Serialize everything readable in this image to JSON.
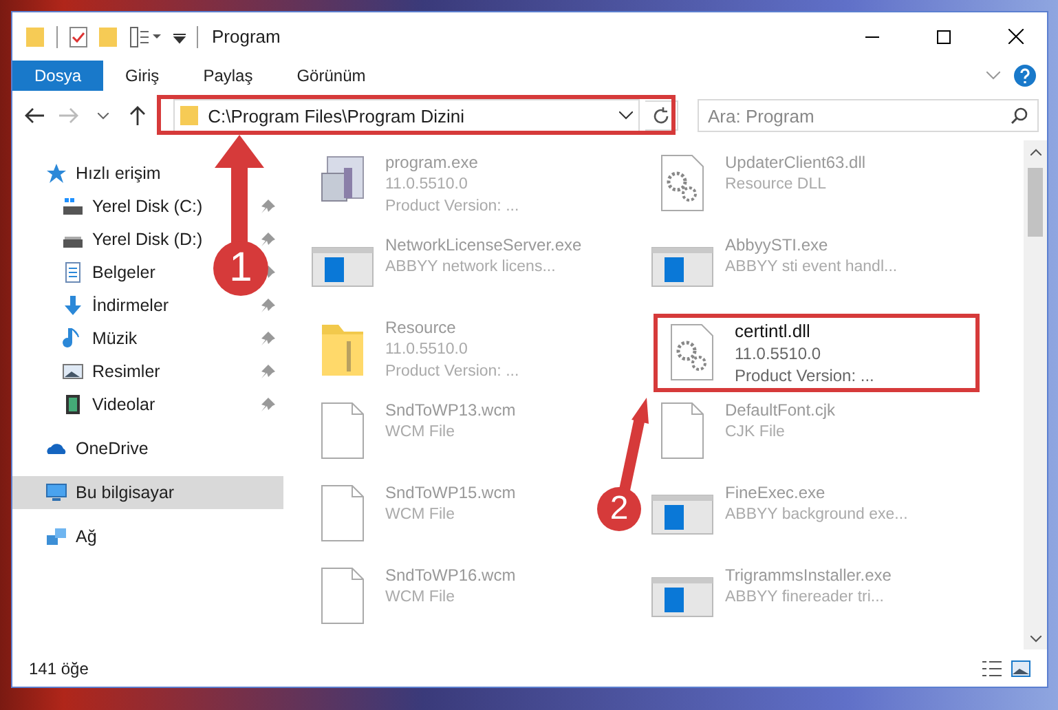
{
  "window": {
    "title": "Program"
  },
  "ribbon_tabs": [
    {
      "label": "Dosya",
      "selected": true
    },
    {
      "label": "Giriş",
      "selected": false
    },
    {
      "label": "Paylaş",
      "selected": false
    },
    {
      "label": "Görünüm",
      "selected": false
    }
  ],
  "address": {
    "path": "C:\\Program Files\\Program Dizini"
  },
  "search": {
    "placeholder": "Ara: Program"
  },
  "sidebar": {
    "items": [
      {
        "label": "Hızlı erişim",
        "kind": "star",
        "selected": false,
        "children": [
          {
            "label": "Yerel Disk (C:)",
            "kind": "drive-c",
            "pinned": true
          },
          {
            "label": "Yerel Disk (D:)",
            "kind": "drive",
            "pinned": true
          },
          {
            "label": "Belgeler",
            "kind": "docs",
            "pinned": true
          },
          {
            "label": "İndirmeler",
            "kind": "download",
            "pinned": true
          },
          {
            "label": "Müzik",
            "kind": "music",
            "pinned": true
          },
          {
            "label": "Resimler",
            "kind": "pictures",
            "pinned": true
          },
          {
            "label": "Videolar",
            "kind": "videos",
            "pinned": true
          }
        ]
      },
      {
        "label": "OneDrive",
        "kind": "cloud",
        "selected": false
      },
      {
        "label": "Bu bilgisayar",
        "kind": "pc",
        "selected": true
      },
      {
        "label": "Ağ",
        "kind": "network",
        "selected": false
      }
    ]
  },
  "files": [
    {
      "name": "program.exe",
      "kind": "app",
      "details": [
        "11.0.5510.0",
        "Product Version:   ..."
      ],
      "focus": false
    },
    {
      "name": "UpdaterClient63.dll",
      "kind": "dll",
      "details": [
        "Resource DLL"
      ],
      "focus": false
    },
    {
      "name": "NetworkLicenseServer.exe",
      "kind": "window-app",
      "details": [
        "ABBYY network licens..."
      ],
      "focus": false
    },
    {
      "name": "AbbyySTI.exe",
      "kind": "window-app",
      "details": [
        "ABBYY sti event handl..."
      ],
      "focus": false
    },
    {
      "name": "Resource",
      "kind": "folder",
      "details": [
        "11.0.5510.0",
        "Product Version:   ..."
      ],
      "focus": false
    },
    {
      "name": "certintl.dll",
      "kind": "dll",
      "details": [
        "11.0.5510.0",
        "Product Version:   ..."
      ],
      "focus": true
    },
    {
      "name": "SndToWP13.wcm",
      "kind": "blank",
      "details": [
        "WCM File"
      ],
      "focus": false
    },
    {
      "name": "DefaultFont.cjk",
      "kind": "blank",
      "details": [
        "CJK File"
      ],
      "focus": false
    },
    {
      "name": "SndToWP15.wcm",
      "kind": "blank",
      "details": [
        "WCM File"
      ],
      "focus": false
    },
    {
      "name": "FineExec.exe",
      "kind": "window-app",
      "details": [
        "ABBYY background exe..."
      ],
      "focus": false
    },
    {
      "name": "SndToWP16.wcm",
      "kind": "blank",
      "details": [
        "WCM File"
      ],
      "focus": false
    },
    {
      "name": "TrigrammsInstaller.exe",
      "kind": "window-app",
      "details": [
        "ABBYY finereader tri..."
      ],
      "focus": false
    }
  ],
  "status_bar": {
    "item_count": "141 öğe"
  },
  "callouts": [
    {
      "label": "1"
    },
    {
      "label": "2"
    }
  ]
}
